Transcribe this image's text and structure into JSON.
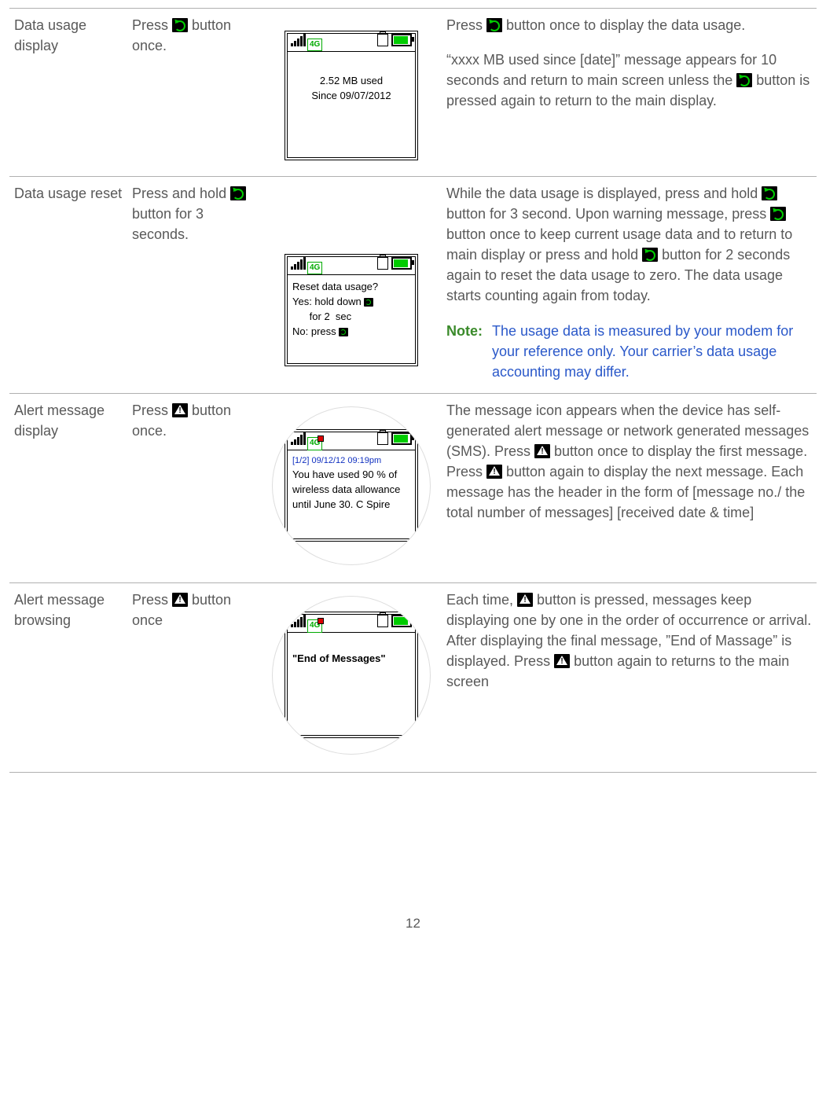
{
  "page_number": "12",
  "rows": [
    {
      "title": "Data usage display",
      "action_pre": "Press ",
      "action_icon": "refresh",
      "action_post": " button once.",
      "screen": {
        "type": "usage",
        "line1": "2.52 MB used",
        "line2": "Since 09/07/2012"
      },
      "desc": {
        "p1a": "Press ",
        "p1b": " button once to display the data usage.",
        "p2a": "“xxxx MB used since [date]” message appears for 10 seconds and return to main screen unless the  ",
        "p2b": " button is pressed again to return to the main display."
      }
    },
    {
      "title": "Data usage reset",
      "action_pre": "Press and hold ",
      "action_icon": "refresh",
      "action_post": " button for 3 seconds.",
      "screen": {
        "type": "reset",
        "line1": "Reset data usage?",
        "line2a": "Yes: hold down ",
        "line2b": "      for 2  sec",
        "line3": "No: press "
      },
      "desc": {
        "p1a": "While the data usage is displayed, press and hold ",
        "p1b": " button for 3 second. Upon warning message, press ",
        "p1c": " button once to keep current usage data and to return to main display or press and hold ",
        "p1d": " button for 2 seconds again to reset the data usage to zero. The data usage starts counting again from today."
      },
      "note_label": "Note:",
      "note_body": "The usage data is measured by your modem for your reference only. Your carrier’s data usage accounting may differ."
    },
    {
      "title": "Alert message display",
      "action_pre": "Press ",
      "action_icon": "alert",
      "action_post": " button once.",
      "screen": {
        "type": "alert_msg",
        "header": "[1/2] 09/12/12 09:19pm",
        "body": "You have used 90 % of wireless data allowance until June 30. C Spire"
      },
      "desc": {
        "p1a": "The message icon appears when the device has self-generated alert message or network generated messages (SMS). Press ",
        "p1b": " button once to display the first message. Press ",
        "p1c": " button again to display the next message. Each message has the header in the form of [message no./ the total number of messages] [received date & time]"
      }
    },
    {
      "title": "Alert message browsing",
      "action_pre": "Press ",
      "action_icon": "alert",
      "action_post": " button once",
      "screen": {
        "type": "end_msg",
        "body": "\"End of Messages\""
      },
      "desc": {
        "p1a": "Each time, ",
        "p1b": " button is pressed, messages keep displaying one by one in the order of occurrence or arrival. After displaying the final message, ”End of Massage” is displayed. Press ",
        "p1c": " button again to returns to the main screen"
      }
    }
  ]
}
